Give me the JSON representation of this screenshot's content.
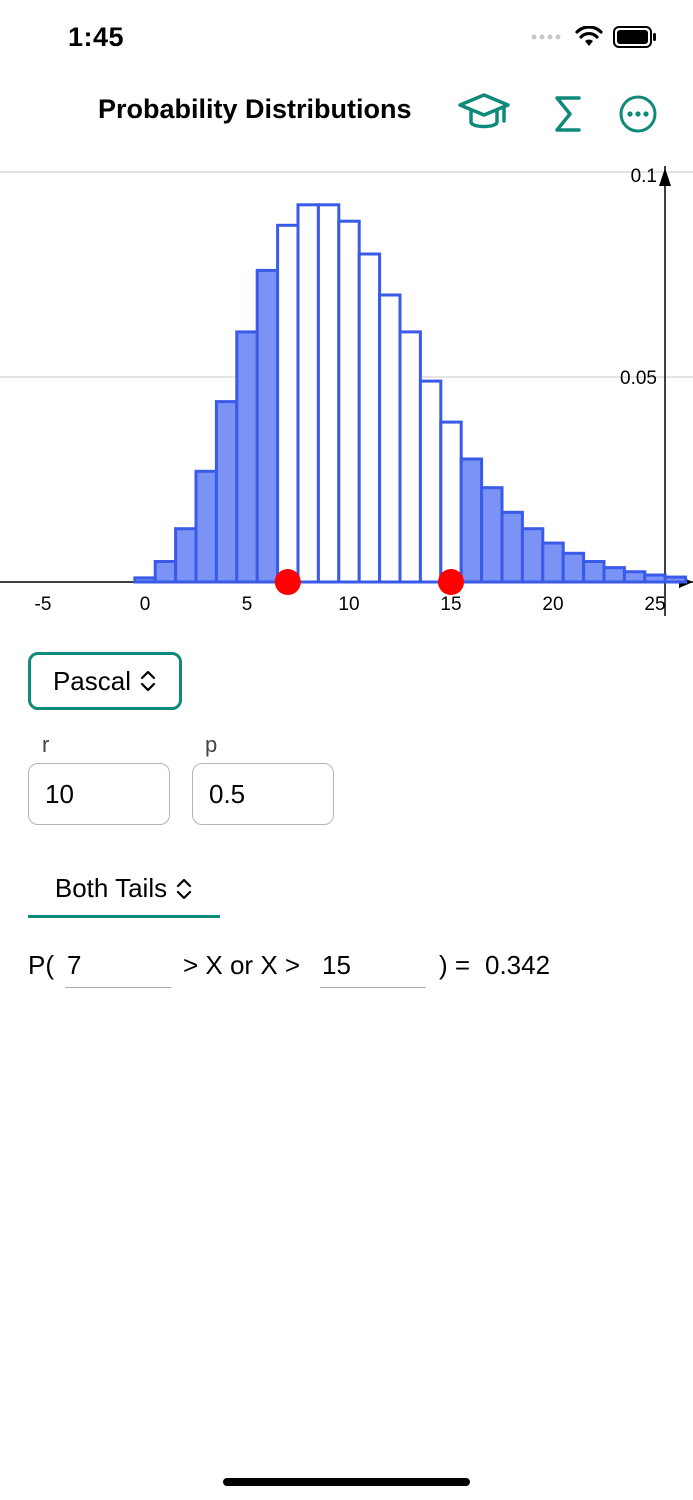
{
  "status_bar": {
    "time": "1:45"
  },
  "nav": {
    "title": "Probability Distributions",
    "icons": [
      "graduation-cap-icon",
      "sigma-icon",
      "more-icon"
    ],
    "accent_color": "#0f8a7a"
  },
  "chart_data": {
    "type": "bar",
    "x": [
      0,
      1,
      2,
      3,
      4,
      5,
      6,
      7,
      8,
      9,
      10,
      11,
      12,
      13,
      14,
      15,
      16,
      17,
      18,
      19,
      20,
      21,
      22,
      23,
      24,
      25,
      26
    ],
    "values": [
      0.001,
      0.005,
      0.013,
      0.027,
      0.044,
      0.061,
      0.076,
      0.087,
      0.092,
      0.092,
      0.088,
      0.08,
      0.07,
      0.061,
      0.049,
      0.039,
      0.03,
      0.023,
      0.017,
      0.013,
      0.0095,
      0.007,
      0.005,
      0.0035,
      0.0025,
      0.0017,
      0.0012
    ],
    "xticks": [
      "-5",
      "0",
      "5",
      "10",
      "15",
      "20",
      "25"
    ],
    "xtick_values": [
      -5,
      0,
      5,
      10,
      15,
      20,
      25
    ],
    "yticks": [
      "0.05",
      "0.1"
    ],
    "ytick_values": [
      0.05,
      0.1
    ],
    "xlim": [
      -7,
      27
    ],
    "ylim": [
      0,
      0.1
    ],
    "markers": [
      7,
      15
    ],
    "marker_color": "#ff0000",
    "fill_color": "#7b93f5",
    "stroke_color": "#3a5ae8",
    "shaded": "tails"
  },
  "distribution": {
    "selected": "Pascal"
  },
  "params": {
    "r": {
      "label": "r",
      "value": "10"
    },
    "p": {
      "label": "p",
      "value": "0.5"
    }
  },
  "tails": {
    "selected": "Both Tails"
  },
  "probability": {
    "prefix": "P(",
    "lower": "7",
    "middle": "> X or X >",
    "upper": "15",
    "suffix": ") =",
    "result": "0.342"
  }
}
